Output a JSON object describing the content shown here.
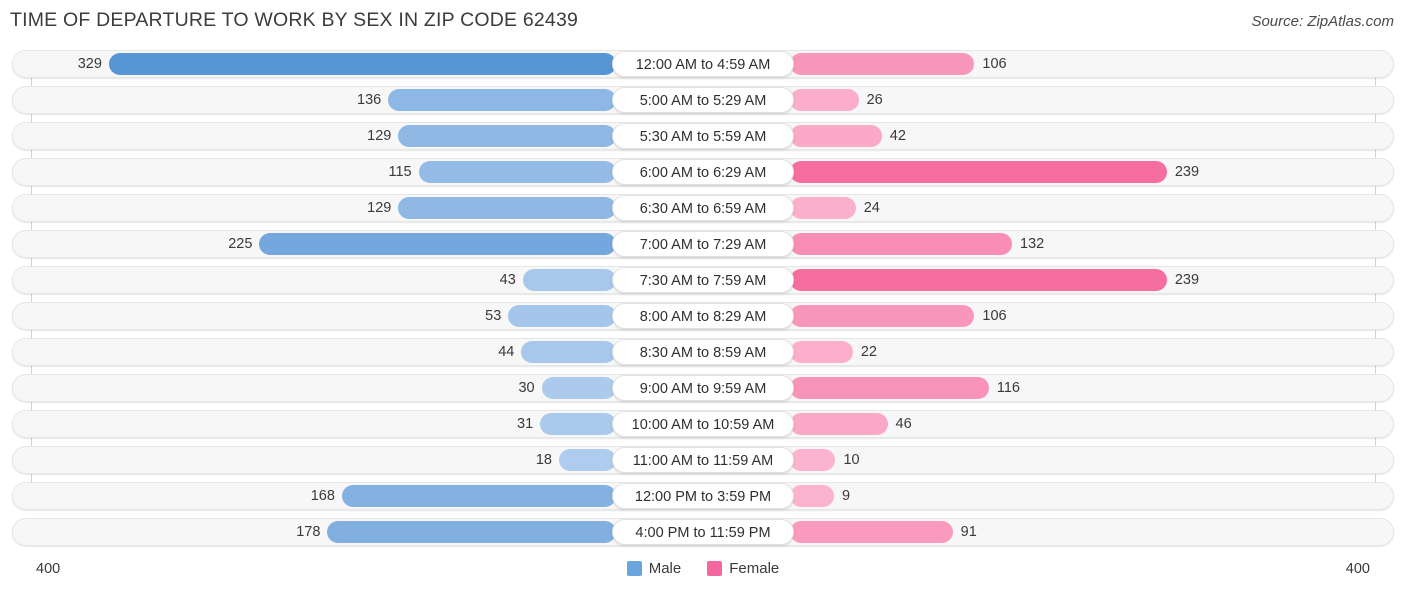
{
  "header": {
    "title": "TIME OF DEPARTURE TO WORK BY SEX IN ZIP CODE 62439",
    "source": "Source: ZipAtlas.com"
  },
  "legend": {
    "male_label": "Male",
    "female_label": "Female",
    "male_color": "#6aa5dd",
    "female_color": "#f4679e"
  },
  "axis": {
    "left_max_label": "400",
    "right_max_label": "400",
    "max": 400
  },
  "chart_data": {
    "type": "bar",
    "title": "TIME OF DEPARTURE TO WORK BY SEX IN ZIP CODE 62439",
    "subtitle": "",
    "orientation": "horizontal-diverging",
    "xlabel": "",
    "ylabel": "",
    "xlim": [
      400,
      400
    ],
    "grid": false,
    "legend_position": "bottom-center",
    "categories": [
      "12:00 AM to 4:59 AM",
      "5:00 AM to 5:29 AM",
      "5:30 AM to 5:59 AM",
      "6:00 AM to 6:29 AM",
      "6:30 AM to 6:59 AM",
      "7:00 AM to 7:29 AM",
      "7:30 AM to 7:59 AM",
      "8:00 AM to 8:29 AM",
      "8:30 AM to 8:59 AM",
      "9:00 AM to 9:59 AM",
      "10:00 AM to 10:59 AM",
      "11:00 AM to 11:59 AM",
      "12:00 PM to 3:59 PM",
      "4:00 PM to 11:59 PM"
    ],
    "series": [
      {
        "name": "Male",
        "color": "#6aa5dd",
        "values": [
          329,
          136,
          129,
          115,
          129,
          225,
          43,
          53,
          44,
          30,
          31,
          18,
          168,
          178
        ]
      },
      {
        "name": "Female",
        "color": "#f4679e",
        "values": [
          106,
          26,
          42,
          239,
          24,
          132,
          239,
          106,
          22,
          116,
          46,
          10,
          9,
          91
        ]
      }
    ]
  },
  "rows": [
    {
      "label": "12:00 AM to 4:59 AM",
      "male": "329",
      "female": "106"
    },
    {
      "label": "5:00 AM to 5:29 AM",
      "male": "136",
      "female": "26"
    },
    {
      "label": "5:30 AM to 5:59 AM",
      "male": "129",
      "female": "42"
    },
    {
      "label": "6:00 AM to 6:29 AM",
      "male": "115",
      "female": "239"
    },
    {
      "label": "6:30 AM to 6:59 AM",
      "male": "129",
      "female": "24"
    },
    {
      "label": "7:00 AM to 7:29 AM",
      "male": "225",
      "female": "132"
    },
    {
      "label": "7:30 AM to 7:59 AM",
      "male": "43",
      "female": "239"
    },
    {
      "label": "8:00 AM to 8:29 AM",
      "male": "53",
      "female": "106"
    },
    {
      "label": "8:30 AM to 8:59 AM",
      "male": "44",
      "female": "22"
    },
    {
      "label": "9:00 AM to 9:59 AM",
      "male": "30",
      "female": "116"
    },
    {
      "label": "10:00 AM to 10:59 AM",
      "male": "31",
      "female": "46"
    },
    {
      "label": "11:00 AM to 11:59 AM",
      "male": "18",
      "female": "10"
    },
    {
      "label": "12:00 PM to 3:59 PM",
      "male": "168",
      "female": "9"
    },
    {
      "label": "4:00 PM to 11:59 PM",
      "male": "178",
      "female": "91"
    }
  ]
}
